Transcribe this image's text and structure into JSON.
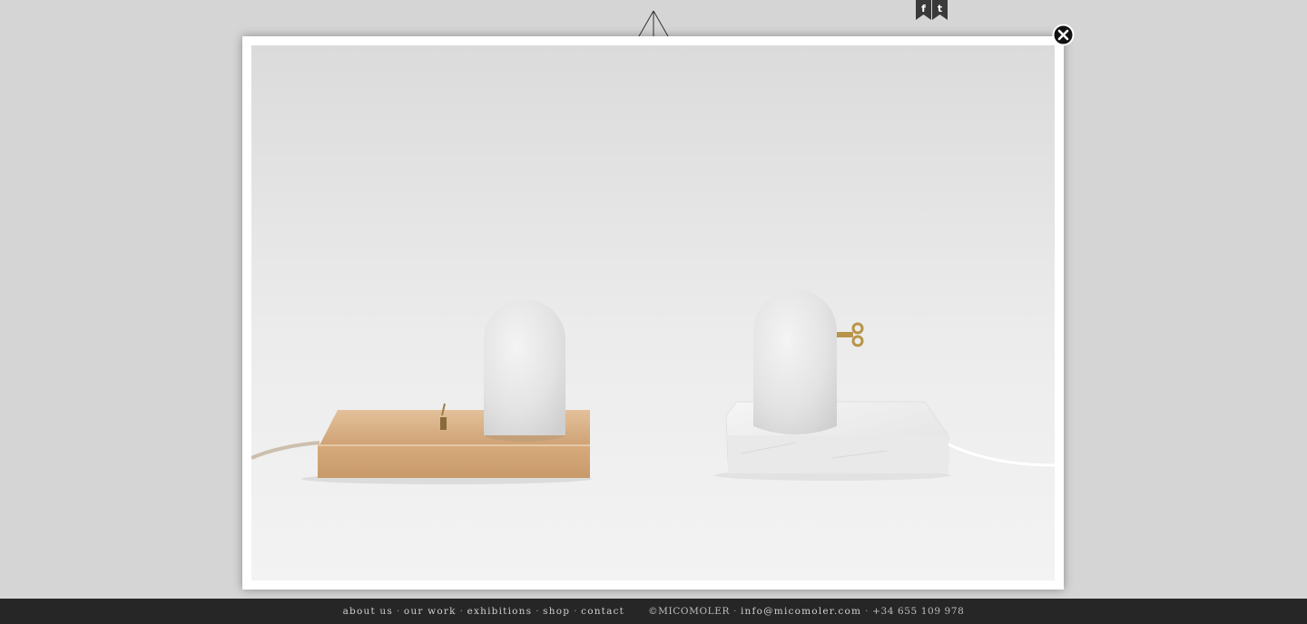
{
  "header": {
    "logo_icon": "triangle-logo-icon",
    "social": [
      {
        "name": "facebook-icon",
        "letter": "f"
      },
      {
        "name": "twitter-icon",
        "letter": "t"
      }
    ]
  },
  "lightbox": {
    "image_icon": "photo-two-lamps",
    "close_icon": "close-icon"
  },
  "footer": {
    "nav": [
      {
        "label": "about us"
      },
      {
        "label": "our work"
      },
      {
        "label": "exhibitions"
      },
      {
        "label": "shop"
      },
      {
        "label": "contact"
      }
    ],
    "separator": "·",
    "copyright": "©MICOMOLER",
    "email": "info@micomoler.com",
    "phone": "+34 655 109 978"
  },
  "colors": {
    "background": "#d5d5d5",
    "footer_bg": "#262626",
    "footer_text": "#cfcfcf",
    "icon_dark": "#3a3a3a"
  }
}
